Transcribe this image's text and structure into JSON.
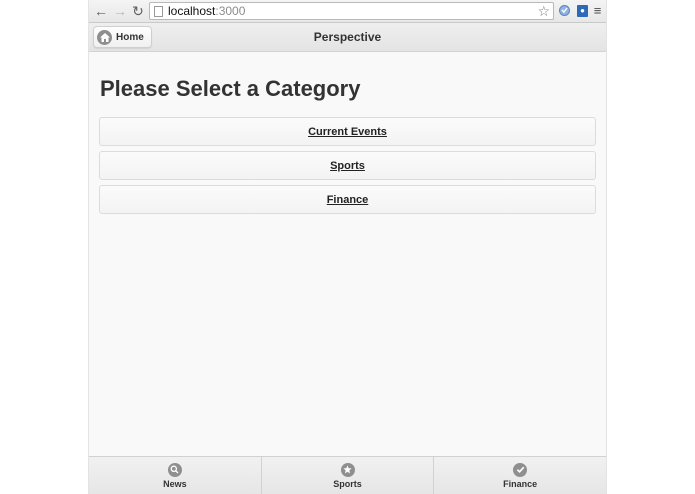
{
  "browser": {
    "url_host": "localhost",
    "url_port": ":3000",
    "back_icon": "←",
    "forward_icon": "→",
    "reload_icon": "↻",
    "star_icon": "☆",
    "menu_icon": "≡"
  },
  "header": {
    "home_label": "Home",
    "title": "Perspective"
  },
  "main": {
    "heading": "Please Select a Category",
    "categories": [
      "Current Events",
      "Sports",
      "Finance"
    ]
  },
  "tabs": [
    {
      "label": "News",
      "icon": "search-icon"
    },
    {
      "label": "Sports",
      "icon": "star-icon"
    },
    {
      "label": "Finance",
      "icon": "check-icon"
    }
  ]
}
